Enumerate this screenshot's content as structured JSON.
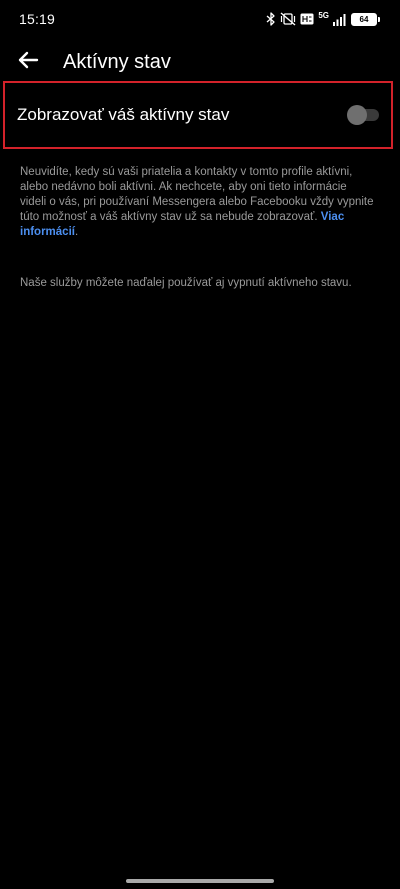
{
  "status_bar": {
    "time": "15:19",
    "network_label": "5G",
    "battery_level": "64",
    "icons": [
      "bluetooth-icon",
      "vibrate-off-icon",
      "volte-icon",
      "signal-icon",
      "battery-icon"
    ]
  },
  "header": {
    "back_icon": "arrow-left-icon",
    "title": "Aktívny stav"
  },
  "setting": {
    "label": "Zobrazovať váš aktívny stav",
    "toggle_on": false
  },
  "description": {
    "text": "Neuvidíte, kedy sú vaši priatelia a kontakty v tomto profile aktívni, alebo nedávno boli aktívni. Ak nechcete, aby oni tieto informácie videli o vás, pri používaní Messengera alebo Facebooku vždy vypnite túto možnosť a váš aktívny stav už sa nebude zobrazovať.",
    "link_label": "Viac informácií",
    "link_suffix": "."
  },
  "note": "Naše služby môžete naďalej používať aj vypnutí aktívneho stavu.",
  "colors": {
    "background": "#000000",
    "highlight_border": "#d3222a",
    "link": "#4c8ff0",
    "secondary_text": "#9a9a9a"
  }
}
